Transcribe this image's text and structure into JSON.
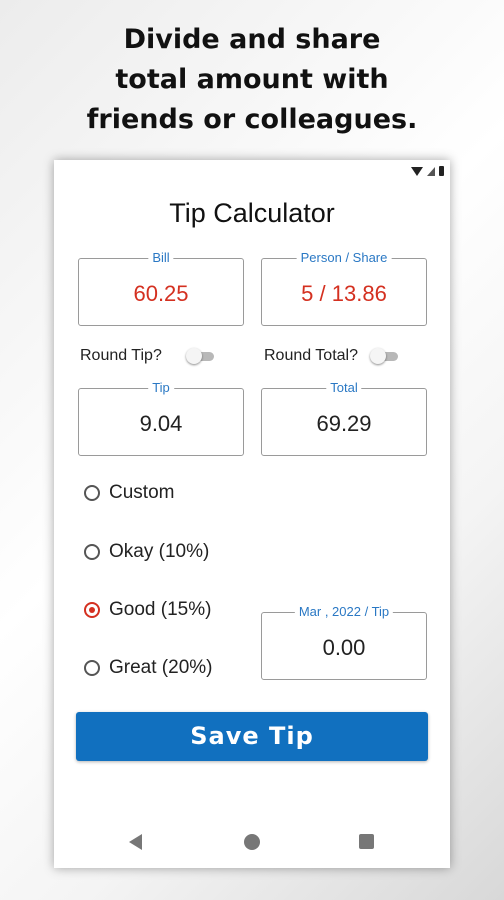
{
  "headline": {
    "line1": "Divide and share",
    "line2": "total amount with",
    "line3": "friends or colleagues."
  },
  "app": {
    "title": "Tip Calculator",
    "bill": {
      "label": "Bill",
      "value": "60.25"
    },
    "person_share": {
      "label": "Person / Share",
      "value": "5 / 13.86"
    },
    "round_tip": {
      "label": "Round Tip?",
      "on": false
    },
    "round_total": {
      "label": "Round Total?",
      "on": false
    },
    "tip": {
      "label": "Tip",
      "value": "9.04"
    },
    "total": {
      "label": "Total",
      "value": "69.29"
    },
    "tip_options": [
      {
        "label": "Custom",
        "selected": false
      },
      {
        "label": "Okay (10%)",
        "selected": false
      },
      {
        "label": "Good (15%)",
        "selected": true
      },
      {
        "label": "Great (20%)",
        "selected": false
      }
    ],
    "monthly_tip": {
      "label": "Mar , 2022 / Tip",
      "value": "0.00"
    },
    "save_button": "Save Tip"
  },
  "colors": {
    "accent_blue": "#1170bf",
    "value_red": "#d43020",
    "label_blue": "#2a78c4"
  },
  "icons": {
    "status": [
      "wifi-icon",
      "signal-icon",
      "battery-icon"
    ],
    "nav": [
      "back-icon",
      "home-icon",
      "recents-icon"
    ]
  }
}
